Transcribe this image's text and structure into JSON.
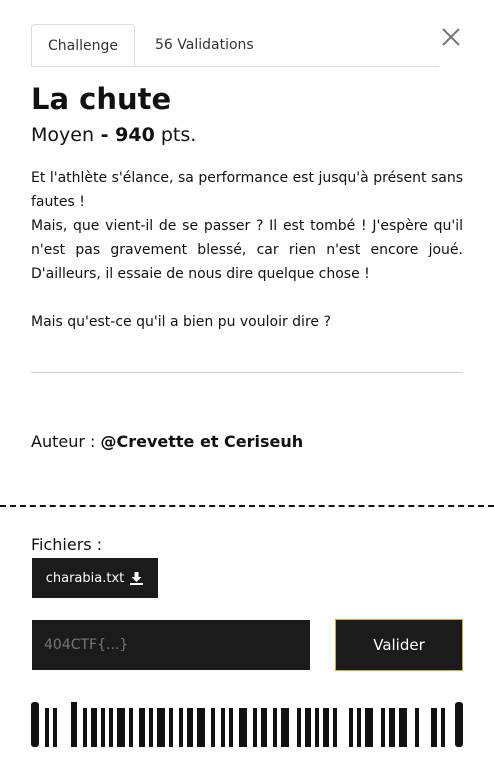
{
  "tabs": {
    "challenge_label": "Challenge",
    "validations_label": "56 Validations"
  },
  "close_icon": "close-icon",
  "challenge": {
    "title": "La chute",
    "difficulty": "Moyen",
    "separator": " - ",
    "points": "940",
    "points_unit": " pts.",
    "description": [
      "Et l'athlète s'élance, sa performance est jusqu'à présent sans fautes !",
      "Mais, que vient-il de se passer ? Il est tombé ! J'espère qu'il n'est pas gravement blessé, car rien n'est encore joué. D'ailleurs, il essaie de nous dire quelque chose !",
      "Mais qu'est-ce qu'il a bien pu vouloir dire ?"
    ]
  },
  "author": {
    "label": "Auteur : ",
    "name": "@Crevette et Ceriseuh"
  },
  "files": {
    "label": "Fichiers :",
    "items": [
      {
        "name": "charabia.txt",
        "icon": "download-icon"
      }
    ]
  },
  "flag_form": {
    "placeholder": "404CTF{...}",
    "submit_label": "Valider"
  },
  "colors": {
    "dark": "#1b1b1b",
    "accent_border": "#d9a832"
  }
}
